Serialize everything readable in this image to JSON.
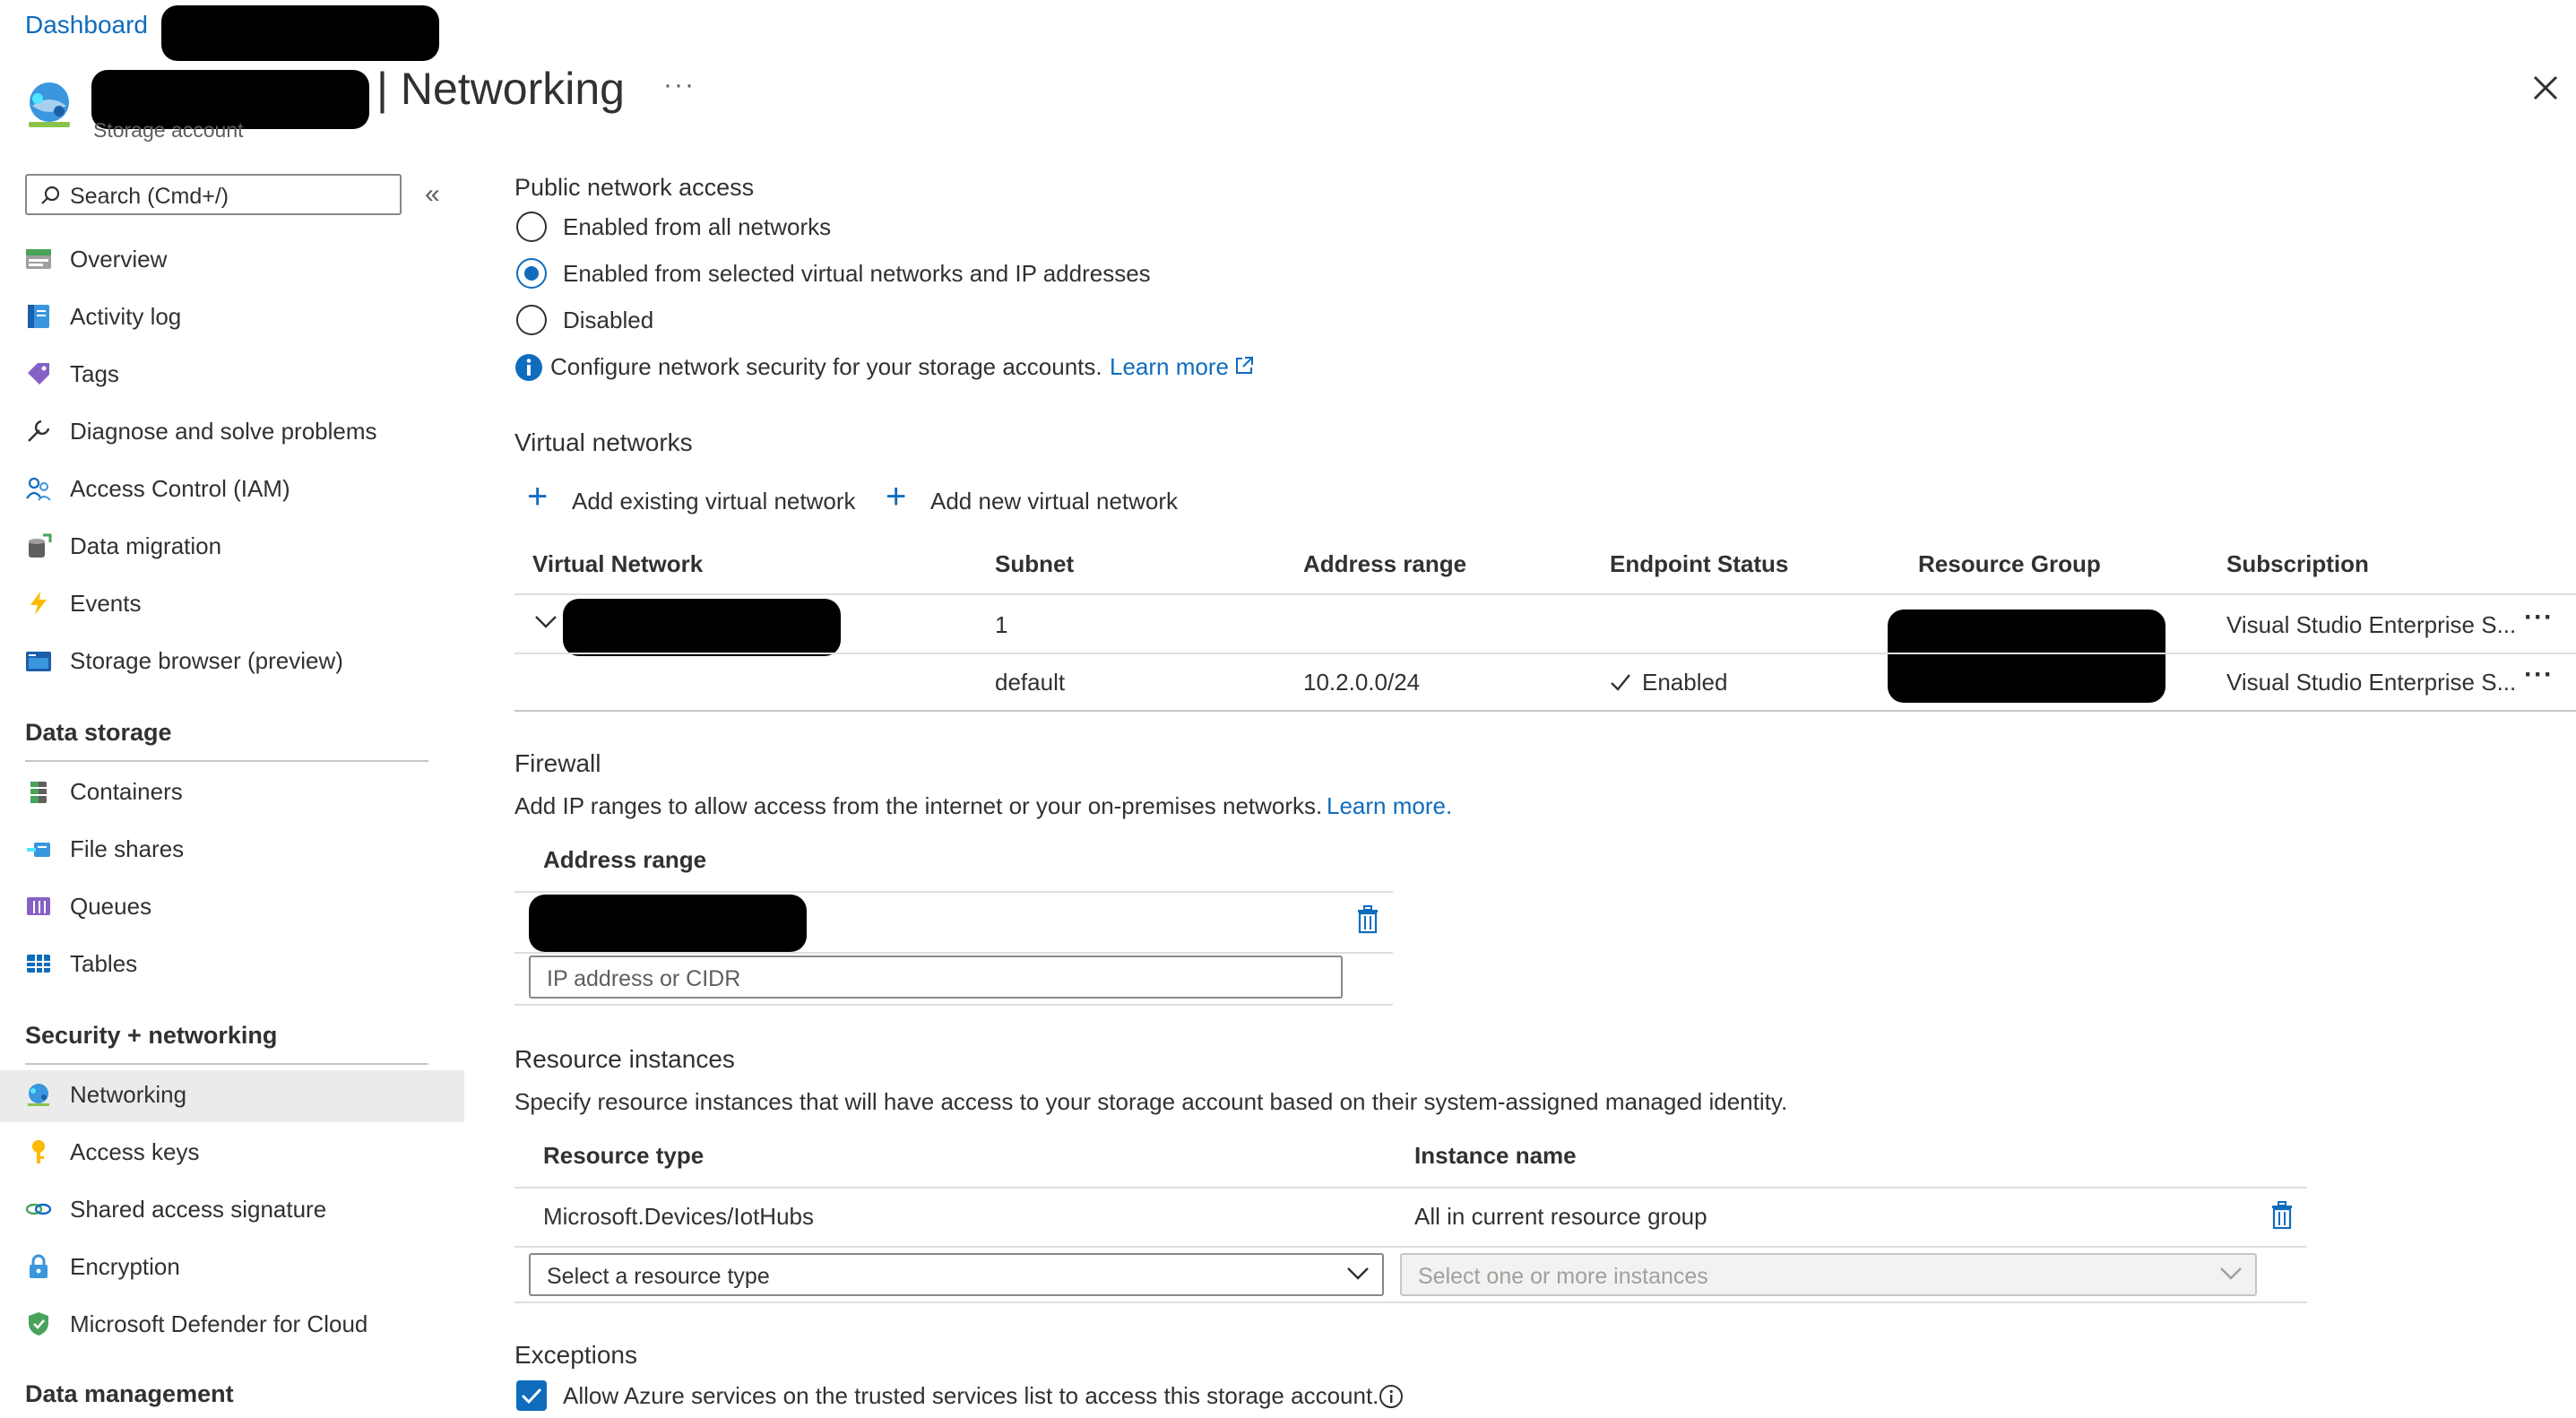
{
  "header": {
    "breadcrumb": "Dashboard",
    "title": "| Networking",
    "subtitle": "Storage account",
    "more": "···"
  },
  "sidebar": {
    "search_placeholder": "Search (Cmd+/)",
    "collapse": "«",
    "items_top": [
      {
        "label": "Overview",
        "icon": "overview-icon"
      },
      {
        "label": "Activity log",
        "icon": "activity-log-icon"
      },
      {
        "label": "Tags",
        "icon": "tag-icon"
      },
      {
        "label": "Diagnose and solve problems",
        "icon": "wrench-icon"
      },
      {
        "label": "Access Control (IAM)",
        "icon": "people-icon"
      },
      {
        "label": "Data migration",
        "icon": "data-migration-icon"
      },
      {
        "label": "Events",
        "icon": "lightning-icon"
      },
      {
        "label": "Storage browser (preview)",
        "icon": "storage-browser-icon"
      }
    ],
    "section_data_storage": "Data storage",
    "items_data_storage": [
      {
        "label": "Containers",
        "icon": "containers-icon"
      },
      {
        "label": "File shares",
        "icon": "file-shares-icon"
      },
      {
        "label": "Queues",
        "icon": "queues-icon"
      },
      {
        "label": "Tables",
        "icon": "tables-icon"
      }
    ],
    "section_security": "Security + networking",
    "items_security": [
      {
        "label": "Networking",
        "icon": "networking-icon",
        "active": true
      },
      {
        "label": "Access keys",
        "icon": "key-icon"
      },
      {
        "label": "Shared access signature",
        "icon": "link-icon"
      },
      {
        "label": "Encryption",
        "icon": "lock-icon"
      },
      {
        "label": "Microsoft Defender for Cloud",
        "icon": "shield-icon"
      }
    ],
    "section_data_management": "Data management"
  },
  "public_access": {
    "heading": "Public network access",
    "options": [
      {
        "label": "Enabled from all networks",
        "selected": false
      },
      {
        "label": "Enabled from selected virtual networks and IP addresses",
        "selected": true
      },
      {
        "label": "Disabled",
        "selected": false
      }
    ],
    "info_text": "Configure network security for your storage accounts.",
    "learn_more": "Learn more"
  },
  "virtual_networks": {
    "heading": "Virtual networks",
    "add_existing": "Add existing virtual network",
    "add_new": "Add new virtual network",
    "columns": [
      "Virtual Network",
      "Subnet",
      "Address range",
      "Endpoint Status",
      "Resource Group",
      "Subscription"
    ],
    "group_row": {
      "subnet": "1",
      "subscription": "Visual Studio Enterprise S..."
    },
    "child_row": {
      "subnet": "default",
      "address_range": "10.2.0.0/24",
      "status": "Enabled",
      "subscription": "Visual Studio Enterprise S..."
    },
    "more": "···"
  },
  "firewall": {
    "heading": "Firewall",
    "description": "Add IP ranges to allow access from the internet or your on-premises networks.",
    "learn_more": "Learn more.",
    "column": "Address range",
    "input_placeholder": "IP address or CIDR"
  },
  "resource_instances": {
    "heading": "Resource instances",
    "description": "Specify resource instances that will have access to your storage account based on their system-assigned managed identity.",
    "columns": [
      "Resource type",
      "Instance name"
    ],
    "row": {
      "type": "Microsoft.Devices/IotHubs",
      "instance": "All in current resource group"
    },
    "type_placeholder": "Select a resource type",
    "instance_placeholder": "Select one or more instances"
  },
  "exceptions": {
    "heading": "Exceptions",
    "allow_trusted": "Allow Azure services on the trusted services list to access this storage account.",
    "allow_trusted_checked": true
  },
  "colors": {
    "accent": "#0f6cbd",
    "active_bg": "#ebebeb"
  }
}
